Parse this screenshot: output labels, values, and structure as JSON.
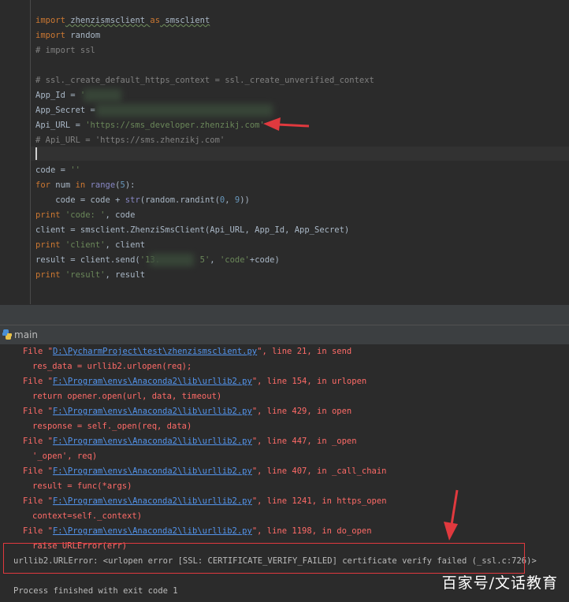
{
  "editor": {
    "lines": {
      "l1_kw_import": "import",
      "l1_mod": " zhenzismsclient ",
      "l1_kw_as": "as",
      "l1_alias": " smsclient",
      "l2_kw": "import",
      "l2_mod": " random",
      "l3": "# import ssl",
      "l5": "# ssl._create_default_https_context = ssl._create_unverified_context",
      "l6_var": "App_Id = ",
      "l6_q": "'",
      "l7_var": "App_Secret = ",
      "l8_var": "Api_URL = ",
      "l8_str": "'https://sms_developer.zhenzikj.com'",
      "l9": "# Api_URL = 'https://sms.zhenzikj.com'",
      "l11_var": "code = ",
      "l11_str": "''",
      "l12_for": "for",
      "l12_a": " num ",
      "l12_in": "in",
      "l12_sp": " ",
      "l12_range": "range",
      "l12_o": "(",
      "l12_num": "5",
      "l12_c": "):",
      "l13_a": "    code = code + ",
      "l13_str_fn": "str",
      "l13_b": "(random.randint(",
      "l13_n0": "0",
      "l13_comma": ", ",
      "l13_n9": "9",
      "l13_c": "))",
      "l14_print": "print",
      "l14_str": " 'code: '",
      "l14_rest": ", code",
      "l15": "client = smsclient.ZhenziSmsClient(Api_URL, App_Id, App_Secret)",
      "l16_print": "print",
      "l16_str": " 'client'",
      "l16_rest": ", client",
      "l17_a": "result = client.send(",
      "l17_str1": "'13.        5'",
      "l17_comma": ", ",
      "l17_str2": "'code'",
      "l17_rest": "+code)",
      "l18_print": "print",
      "l18_str": " 'result'",
      "l18_rest": ", result"
    }
  },
  "run_panel": {
    "tab_label": "main"
  },
  "console": {
    "traceback": [
      {
        "file": "D:\\PycharmProject\\test\\zhenzismsclient.py",
        "line": "21",
        "func": "send",
        "code": "res_data = urllib2.urlopen(req);"
      },
      {
        "file": "F:\\Program\\envs\\Anaconda2\\lib\\urllib2.py",
        "line": "154",
        "func": "urlopen",
        "code": "return opener.open(url, data, timeout)"
      },
      {
        "file": "F:\\Program\\envs\\Anaconda2\\lib\\urllib2.py",
        "line": "429",
        "func": "open",
        "code": "response = self._open(req, data)"
      },
      {
        "file": "F:\\Program\\envs\\Anaconda2\\lib\\urllib2.py",
        "line": "447",
        "func": "_open",
        "code": "'_open', req)"
      },
      {
        "file": "F:\\Program\\envs\\Anaconda2\\lib\\urllib2.py",
        "line": "407",
        "func": "_call_chain",
        "code": "result = func(*args)"
      },
      {
        "file": "F:\\Program\\envs\\Anaconda2\\lib\\urllib2.py",
        "line": "1241",
        "func": "https_open",
        "code": "context=self._context)"
      },
      {
        "file": "F:\\Program\\envs\\Anaconda2\\lib\\urllib2.py",
        "line": "1198",
        "func": "do_open",
        "code": "raise URLError(err)"
      }
    ],
    "file_prefix": "File \"",
    "line_prefix": "\", line ",
    "in_prefix": ", in ",
    "error": "urllib2.URLError: <urlopen error [SSL: CERTIFICATE_VERIFY_FAILED] certificate verify failed (_ssl.c:726)>",
    "exit": "Process finished with exit code 1"
  },
  "watermark": "百家号/文话教育",
  "colors": {
    "background": "#2b2b2b",
    "error_red": "#ff6b68",
    "annotation_red": "#e0393e",
    "link_blue": "#5394ec"
  }
}
